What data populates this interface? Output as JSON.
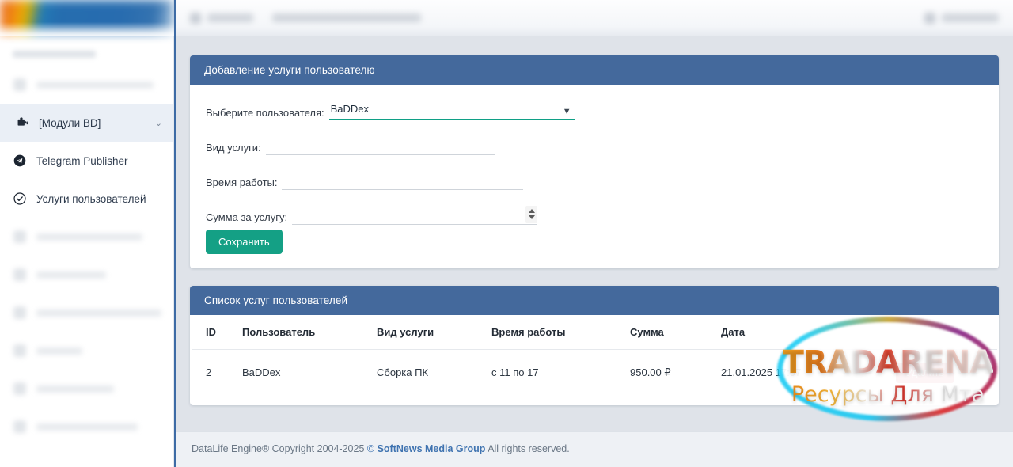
{
  "sidebar": {
    "brand_colors": [
      "#e8681a",
      "#f0a000",
      "#1e69ad"
    ],
    "blurred_label": "",
    "items": [
      {
        "label": "",
        "icon": "blurred-icon",
        "state": "blurred"
      },
      {
        "label": "[Модули BD]",
        "icon": "puzzle-piece-icon",
        "state": "active",
        "chevron": "⌄"
      },
      {
        "label": "Telegram Publisher",
        "icon": "telegram-icon",
        "state": "normal"
      },
      {
        "label": "Услуги пользователей",
        "icon": "check-circle-icon",
        "state": "normal"
      },
      {
        "label": "",
        "icon": "blurred-icon",
        "state": "blurred"
      },
      {
        "label": "",
        "icon": "blurred-icon",
        "state": "blurred"
      },
      {
        "label": "",
        "icon": "blurred-icon",
        "state": "blurred"
      },
      {
        "label": "",
        "icon": "blurred-icon",
        "state": "blurred"
      },
      {
        "label": "",
        "icon": "blurred-icon",
        "state": "blurred"
      },
      {
        "label": "",
        "icon": "blurred-icon",
        "state": "blurred"
      }
    ]
  },
  "topbar": {
    "left_blurred": "",
    "right_blurred": ""
  },
  "form_panel": {
    "title": "Добавление услуги пользователю",
    "fields": {
      "user_label": "Выберите пользователя:",
      "user_value": "BaDDex",
      "service_label": "Вид услуги:",
      "service_value": "",
      "service_placeholder": "",
      "time_label": "Время работы:",
      "time_value": "",
      "time_placeholder": "",
      "sum_label": "Сумма за услугу:",
      "sum_value": "",
      "sum_placeholder": ""
    },
    "save_label": "Сохранить",
    "save_color": "#14a085",
    "accent_underline": "#10a086"
  },
  "list_panel": {
    "title": "Список услуг пользователей",
    "columns": [
      "ID",
      "Пользователь",
      "Вид услуги",
      "Время работы",
      "Сумма",
      "Дата",
      ""
    ],
    "rows": [
      {
        "id": "2",
        "user": "BaDDex",
        "service": "Сборка ПК",
        "time": "с 11 по 17",
        "sum": "950.00 ₽",
        "date": "21.01.2025 17:07",
        "action_label": "Удалить"
      }
    ],
    "delete_color": "#e04a50"
  },
  "footer": {
    "part1": "DataLife Engine",
    "reg": "®",
    "part2": " Copyright 2004-2025 ",
    "copy": "©",
    "brand": "SoftNews Media Group",
    "part3": " All rights reserved."
  },
  "watermark": {
    "line1": "TRADARENA",
    "line2": "Ресурсы Для Мта"
  },
  "theme": {
    "panel_header": "#44699c",
    "page_bg": "#dfe3e9",
    "sidebar_bg": "#ffffff",
    "active_item_bg": "#eaeff6"
  }
}
